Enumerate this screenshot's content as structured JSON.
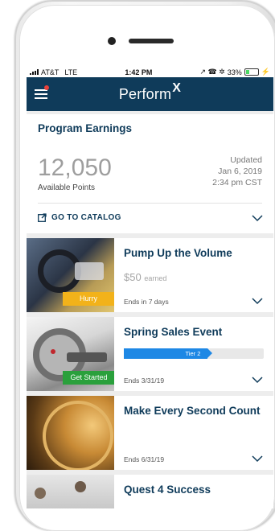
{
  "status_bar": {
    "carrier": "AT&T",
    "network": "LTE",
    "time": "1:42 PM",
    "indicators": "↗ ☎ ✲",
    "battery": "33%",
    "battery_level": 0.33
  },
  "navbar": {
    "logo_text": "Perform",
    "logo_mark": "X",
    "menu_icon": "hamburger-icon",
    "notification_dot_color": "#e8413b"
  },
  "earnings": {
    "title": "Program Earnings",
    "points": "12,050",
    "points_label": "Available Points",
    "updated_label": "Updated",
    "updated_date": "Jan 6, 2019",
    "updated_time": "2:34 pm CST",
    "catalog_link": "GO TO CATALOG"
  },
  "quests": [
    {
      "title": "Pump Up the Volume",
      "earned_amount": "$50",
      "earned_label": "earned",
      "badge": "Hurry",
      "badge_color": "#f2b21a",
      "ends": "Ends in 7 days"
    },
    {
      "title": "Spring Sales Event",
      "tier_label": "Tier 2",
      "tier_progress": 0.6,
      "badge": "Get Started",
      "badge_color": "#2aa03c",
      "ends": "Ends 3/31/19"
    },
    {
      "title": "Make Every Second Count",
      "ends": "Ends 6/31/19"
    },
    {
      "title": "Quest 4 Success"
    }
  ],
  "colors": {
    "brand_navy": "#0f3b5a",
    "tier_blue": "#1e88e5"
  }
}
